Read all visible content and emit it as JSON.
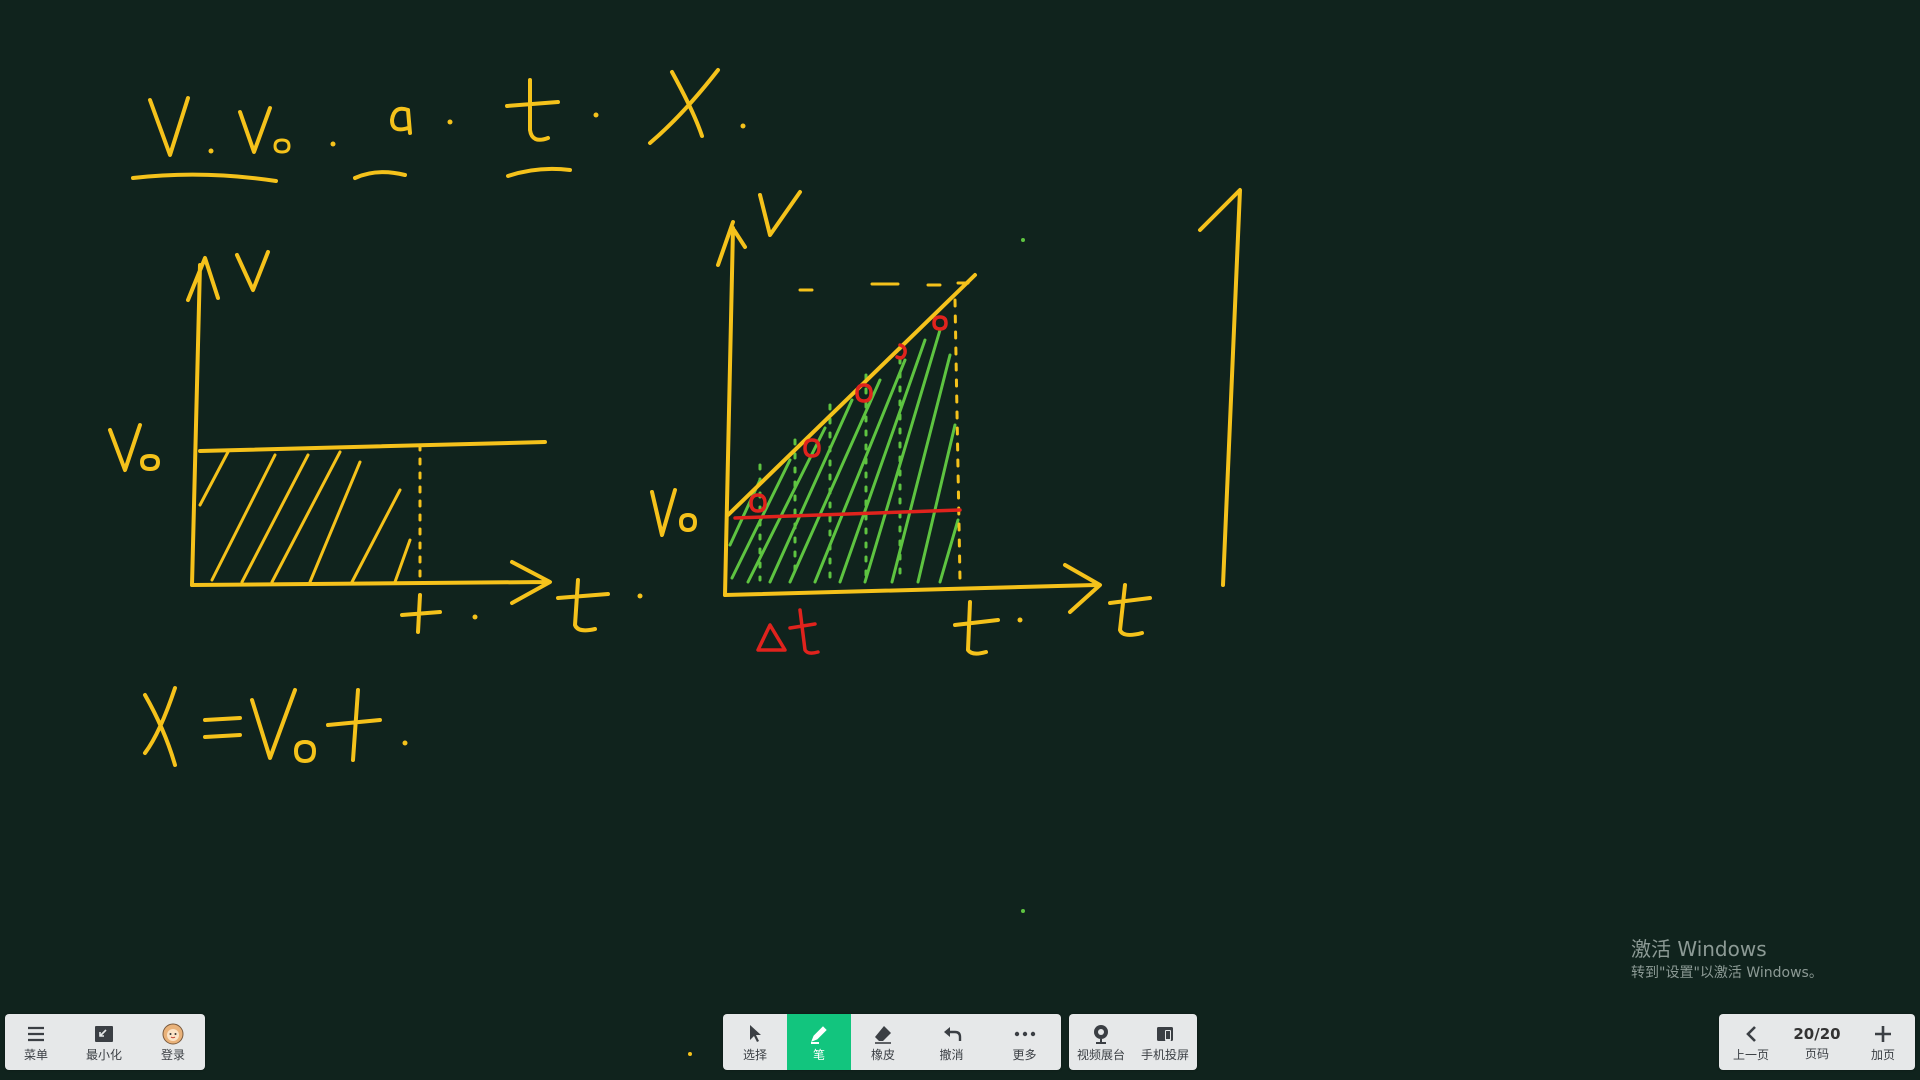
{
  "board": {
    "variables": [
      "v",
      "v₀",
      "a",
      "t",
      "x"
    ],
    "formula": "x = v₀t",
    "graph1": {
      "y_axis": "v",
      "x_axis": "t",
      "y_level_label": "v₀",
      "x_mark_label": "t"
    },
    "graph2": {
      "y_axis": "v",
      "x_axis": "t",
      "y_start_label": "v₀",
      "x_mark_label": "t",
      "interval_label": "Δt"
    },
    "pen_colors": {
      "yellow": "#f5c21b",
      "green": "#5ec441",
      "red": "#e0231d"
    },
    "background": "#10231d"
  },
  "toolbar_left": {
    "menu": {
      "label": "菜单",
      "icon": "menu-icon"
    },
    "minimize": {
      "label": "最小化",
      "icon": "minimize-icon"
    },
    "login": {
      "label": "登录",
      "icon": "avatar-icon"
    }
  },
  "toolbar_center": {
    "select": {
      "label": "选择",
      "icon": "cursor-icon"
    },
    "pen": {
      "label": "笔",
      "icon": "pen-icon",
      "active": true
    },
    "eraser": {
      "label": "橡皮",
      "icon": "eraser-icon"
    },
    "undo": {
      "label": "撤消",
      "icon": "undo-icon"
    },
    "more": {
      "label": "更多",
      "icon": "more-icon"
    }
  },
  "toolbar_media": {
    "camera": {
      "label": "视频展台",
      "icon": "camera-icon"
    },
    "cast": {
      "label": "手机投屏",
      "icon": "cast-icon"
    }
  },
  "toolbar_right": {
    "prev": {
      "label": "上一页",
      "icon": "chevron-left-icon"
    },
    "page": {
      "label": "页码",
      "value": "20/20"
    },
    "add": {
      "label": "加页",
      "icon": "plus-icon"
    }
  },
  "watermark": {
    "title": "激活 Windows",
    "subtitle": "转到\"设置\"以激活 Windows。"
  }
}
